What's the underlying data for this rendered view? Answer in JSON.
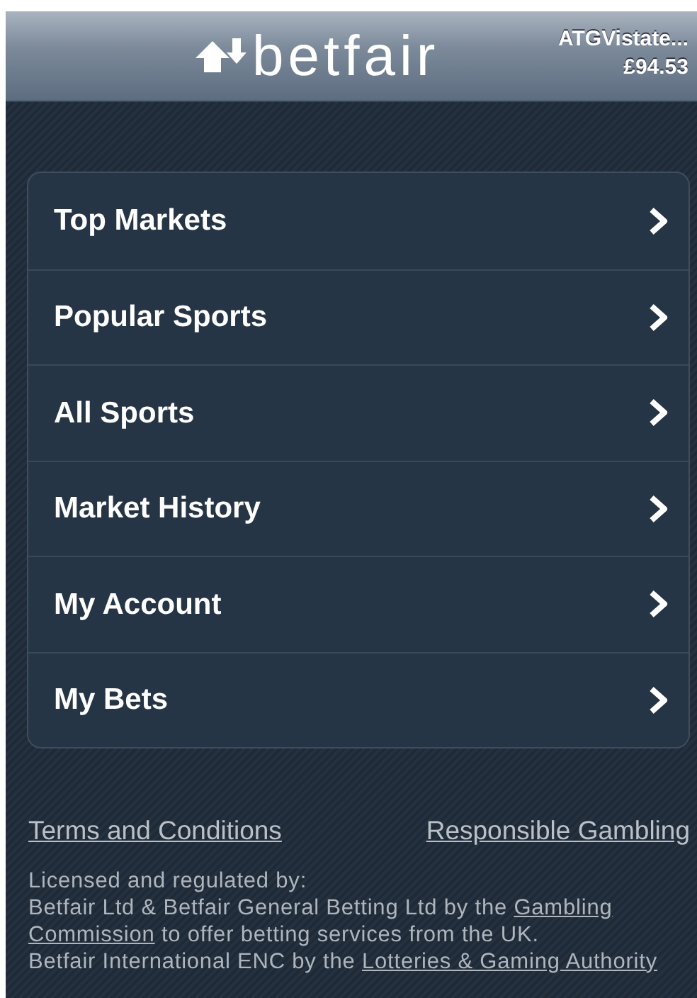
{
  "header": {
    "logo": "betfair",
    "account": {
      "name": "ATGVistate...",
      "balance": "£94.53"
    }
  },
  "menu": [
    {
      "label": "Top Markets"
    },
    {
      "label": "Popular Sports"
    },
    {
      "label": "All Sports"
    },
    {
      "label": "Market History"
    },
    {
      "label": "My Account"
    },
    {
      "label": "My Bets"
    }
  ],
  "footer": {
    "links": [
      "Terms and Conditions",
      "Responsible Gambling"
    ],
    "license": [
      [
        {
          "text": "Licensed and regulated by:",
          "kind": "text"
        }
      ],
      [
        {
          "text": "Betfair Ltd & Betfair General Betting Ltd by the ",
          "kind": "text"
        },
        {
          "text": "Gambling",
          "kind": "link"
        }
      ],
      [
        {
          "text": "Commission",
          "kind": "link"
        },
        {
          "text": " to offer betting services from the UK.",
          "kind": "text"
        }
      ],
      [
        {
          "text": "Betfair International ENC by the ",
          "kind": "text"
        },
        {
          "text": "Lotteries & Gaming Authority",
          "kind": "link"
        }
      ]
    ]
  }
}
